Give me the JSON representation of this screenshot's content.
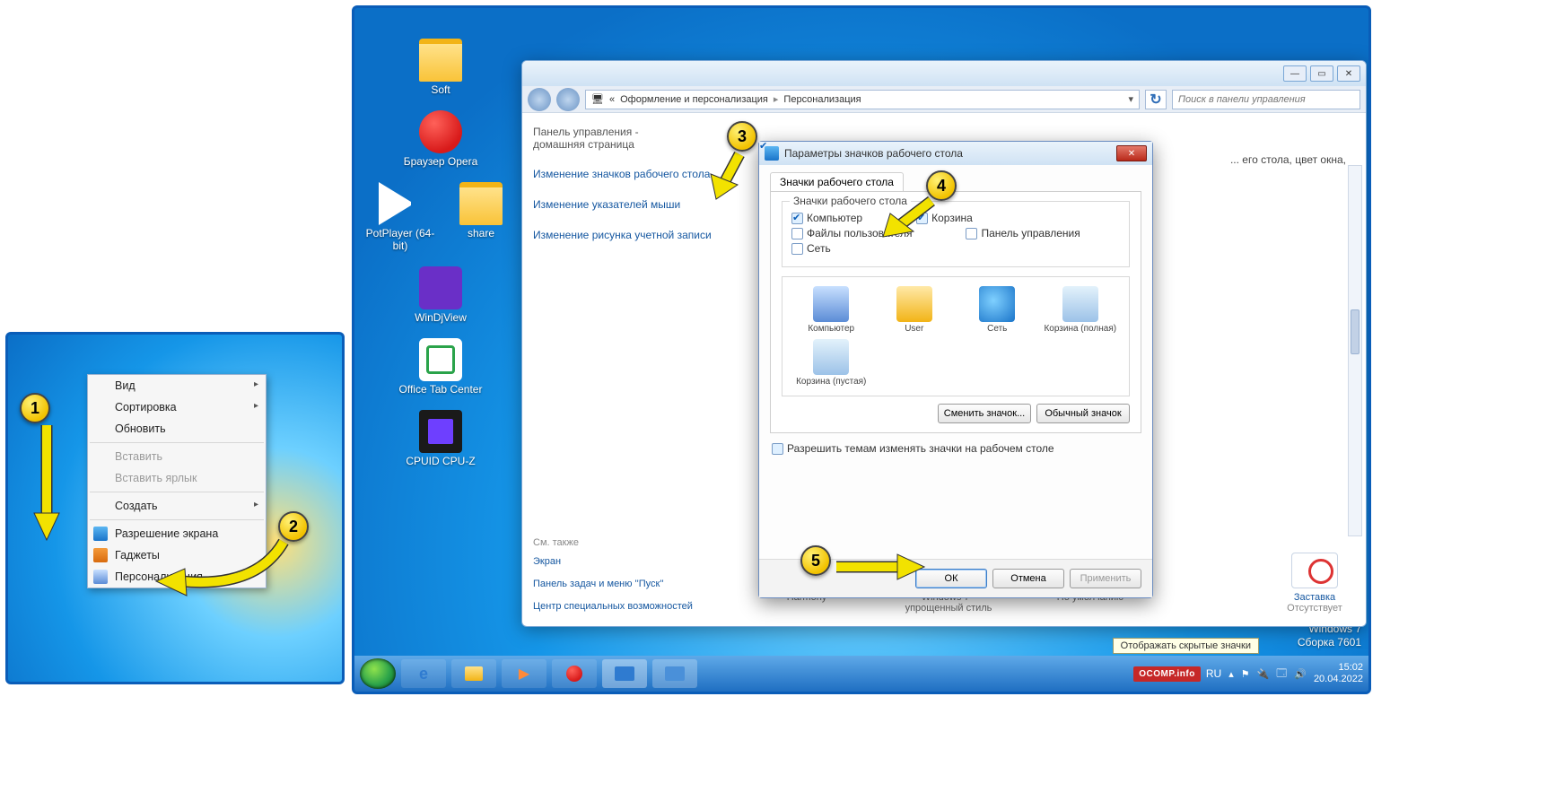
{
  "panelA": {
    "context_menu": {
      "items": [
        {
          "label": "Вид",
          "type": "arr"
        },
        {
          "label": "Сортировка",
          "type": "arr"
        },
        {
          "label": "Обновить",
          "type": "plain"
        },
        {
          "type": "sep"
        },
        {
          "label": "Вставить",
          "type": "dis"
        },
        {
          "label": "Вставить ярлык",
          "type": "dis"
        },
        {
          "type": "sep"
        },
        {
          "label": "Создать",
          "type": "arr"
        },
        {
          "type": "sep"
        },
        {
          "label": "Разрешение экрана",
          "type": "plain",
          "icon": "mi-res"
        },
        {
          "label": "Гаджеты",
          "type": "plain",
          "icon": "mi-gad"
        },
        {
          "label": "Персонализация",
          "type": "plain",
          "icon": "mi-per"
        }
      ]
    }
  },
  "panelB": {
    "desktop_icons": [
      {
        "label": "Soft",
        "icon": "ico-folder"
      },
      {
        "label": "Браузер Opera",
        "icon": "ico-opera"
      },
      {
        "label": "PotPlayer (64-bit)",
        "icon": "ico-play"
      },
      {
        "label": "share",
        "icon": "ico-folder"
      },
      {
        "label": "WinDjView",
        "icon": "ico-purple"
      },
      {
        "label": "Office Tab Center",
        "icon": "ico-otc"
      },
      {
        "label": "CPUID CPU-Z",
        "icon": "ico-cpu"
      }
    ],
    "explorer": {
      "breadcrumb": {
        "pre": "«",
        "a": "Оформление и персонализация",
        "b": "Персонализация"
      },
      "search_placeholder": "Поиск в панели управления",
      "home1": "Панель управления -",
      "home2": "домашняя страница",
      "links": [
        "Изменение значков рабочего стола",
        "Изменение указателей мыши",
        "Изменение рисунка учетной записи"
      ],
      "also_label": "См. также",
      "also": [
        "Экран",
        "Панель задач и меню ''Пуск''",
        "Центр специальных возможностей"
      ],
      "hint": "... его стола, цвет окна,",
      "themes": [
        "Harmony",
        "Windows 7 - упрощенный стиль",
        "По умолчанию"
      ],
      "saver": {
        "title": "Заставка",
        "state": "Отсутствует"
      }
    },
    "dialog": {
      "title": "Параметры значков рабочего стола",
      "tab": "Значки рабочего стола",
      "legend": "Значки рабочего стола",
      "checks": {
        "computer": "Компьютер",
        "userfiles": "Файлы пользователя",
        "network": "Сеть",
        "recycle": "Корзина",
        "cpanel": "Панель управления"
      },
      "icons": [
        {
          "label": "Компьютер",
          "cls": "ic-comp"
        },
        {
          "label": "User",
          "cls": "ic-user"
        },
        {
          "label": "Сеть",
          "cls": "ic-net"
        },
        {
          "label": "Корзина (полная)",
          "cls": "ic-bin"
        },
        {
          "label": "Корзина (пустая)",
          "cls": "ic-bin"
        }
      ],
      "btn_change": "Сменить значок...",
      "btn_default": "Обычный значок",
      "allow": "Разрешить темам изменять значки на рабочем столе",
      "ok": "ОК",
      "cancel": "Отмена",
      "apply": "Применить"
    },
    "taskbar": {
      "ocomp": "OCOMP.info",
      "lang": "RU",
      "time": "15:02",
      "date": "20.04.2022",
      "tray_tooltip": "Отображать скрытые значки"
    },
    "watermark": {
      "l1": "Windows 7",
      "l2": "Сборка 7601"
    }
  },
  "callouts": [
    "1",
    "2",
    "3",
    "4",
    "5"
  ]
}
